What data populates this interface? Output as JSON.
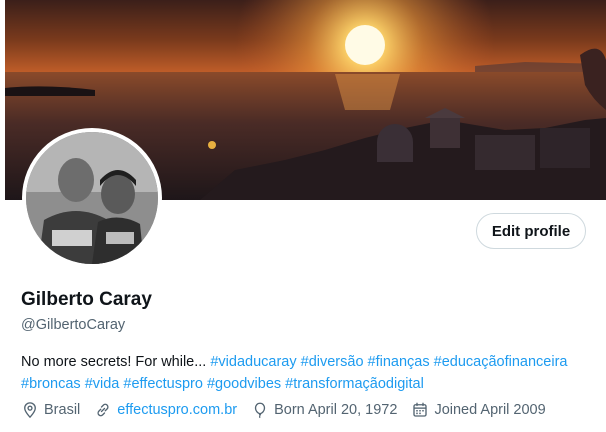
{
  "profile": {
    "display_name": "Gilberto Caray",
    "handle": "@GilbertoCaray",
    "edit_button_label": "Edit profile",
    "bio_text": "No more secrets! For while...",
    "bio_hashtags": [
      "#vidaducaray",
      "#diversão",
      "#finanças",
      "#educaçãofinanceira",
      "#broncas",
      "#vida",
      "#effectuspro",
      "#goodvibes",
      "#transformaçãodigital"
    ],
    "location": "Brasil",
    "website": "effectuspro.com.br",
    "birthday": "Born April 20, 1972",
    "joined": "Joined April 2009"
  },
  "icons": {
    "location": "location-pin-icon",
    "website": "link-icon",
    "birthday": "balloon-icon",
    "joined": "calendar-icon"
  },
  "colors": {
    "accent": "#1d9bf0",
    "text_primary": "#0f1419",
    "text_secondary": "#536471",
    "button_border": "#cfd9de"
  }
}
